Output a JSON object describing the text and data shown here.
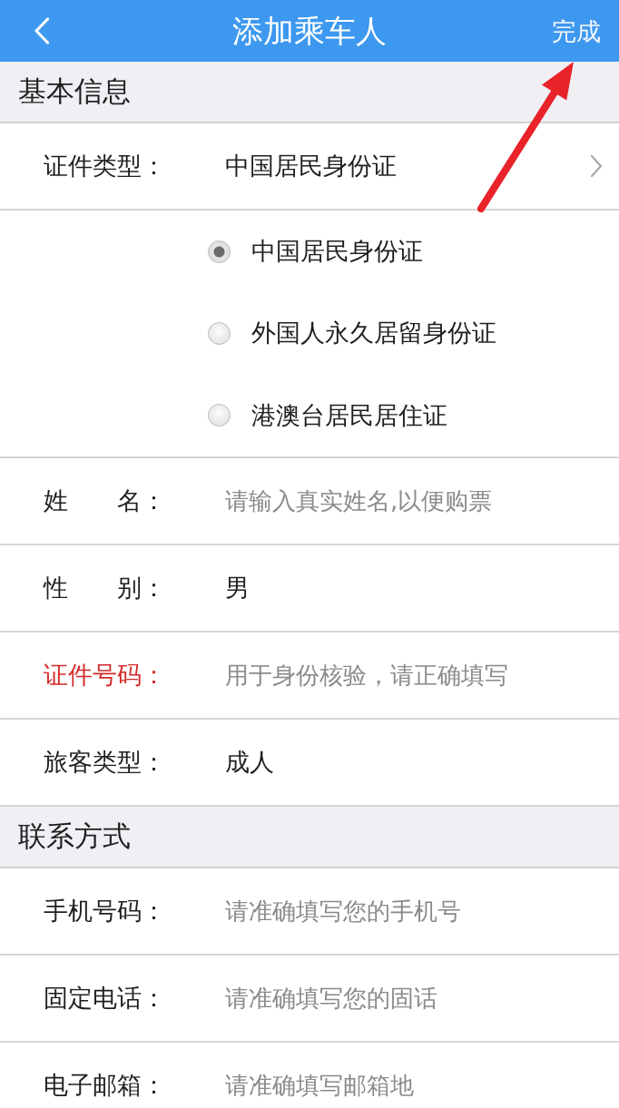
{
  "header": {
    "title": "添加乘车人",
    "action": "完成"
  },
  "annotation": {
    "kind": "arrow"
  },
  "sections": [
    {
      "title": "基本信息",
      "fields": [
        {
          "kind": "select",
          "label": "证件类型：",
          "value": "中国居民身份证",
          "required": false,
          "options": [
            {
              "label": "中国居民身份证",
              "selected": true
            },
            {
              "label": "外国人永久居留身份证",
              "selected": false
            },
            {
              "label": "港澳台居民居住证",
              "selected": false
            }
          ]
        },
        {
          "kind": "input",
          "label": "姓　　名：",
          "placeholder": "请输入真实姓名,以便购票",
          "required": false
        },
        {
          "kind": "value",
          "label": "性　　别：",
          "value": "男",
          "required": false
        },
        {
          "kind": "input",
          "label": "证件号码：",
          "placeholder": "用于身份核验，请正确填写",
          "required": true
        },
        {
          "kind": "value",
          "label": "旅客类型：",
          "value": "成人",
          "required": false
        }
      ]
    },
    {
      "title": "联系方式",
      "fields": [
        {
          "kind": "input",
          "label": "手机号码：",
          "placeholder": "请准确填写您的手机号",
          "required": false
        },
        {
          "kind": "input",
          "label": "固定电话：",
          "placeholder": "请准确填写您的固话",
          "required": false
        },
        {
          "kind": "input",
          "label": "电子邮箱：",
          "placeholder": "请准确填写邮箱地",
          "required": false
        }
      ]
    }
  ]
}
